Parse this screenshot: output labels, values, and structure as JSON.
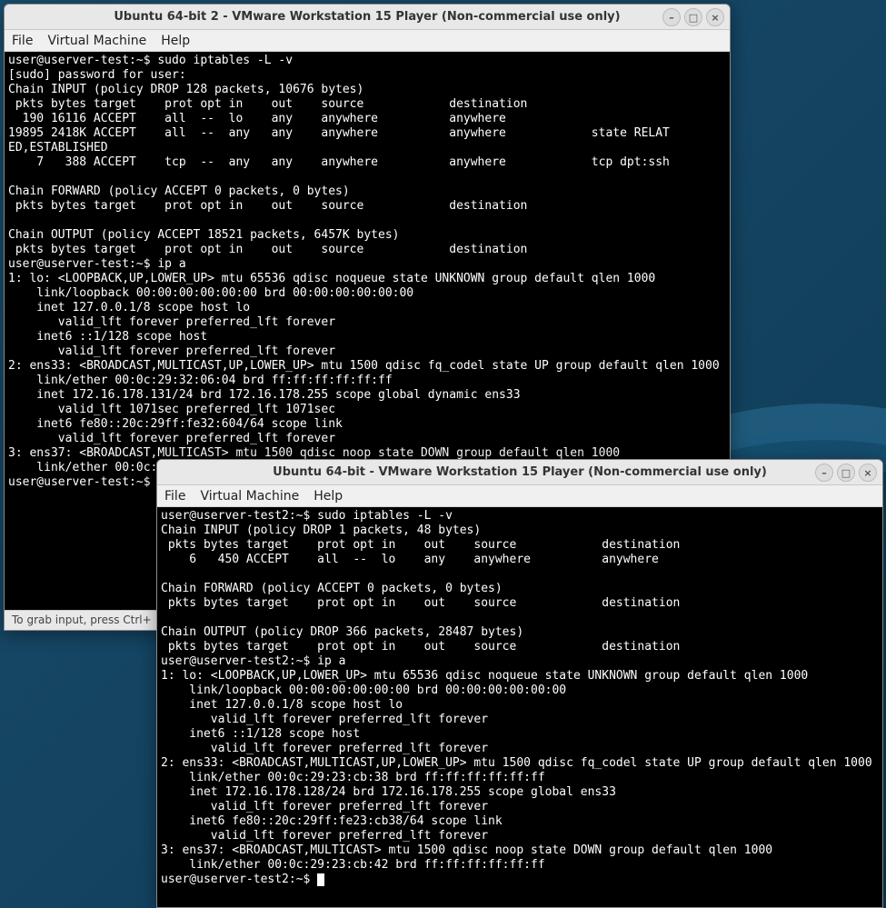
{
  "desktop": {
    "background_colors": [
      "#1a4d6d",
      "#0d3a55"
    ]
  },
  "window1": {
    "title": "Ubuntu 64-bit 2 - VMware Workstation 15 Player (Non-commercial use only)",
    "menu": {
      "file": "File",
      "vm": "Virtual Machine",
      "help": "Help"
    },
    "controls": {
      "min": "–",
      "max": "□",
      "close": "×"
    },
    "status": "To grab input, press Ctrl+",
    "terminal_lines": [
      "user@userver-test:~$ sudo iptables -L -v",
      "[sudo] password for user:",
      "Chain INPUT (policy DROP 128 packets, 10676 bytes)",
      " pkts bytes target    prot opt in    out    source            destination",
      "  190 16116 ACCEPT    all  --  lo    any    anywhere          anywhere",
      "19895 2418K ACCEPT    all  --  any   any    anywhere          anywhere            state RELAT",
      "ED,ESTABLISHED",
      "    7   388 ACCEPT    tcp  --  any   any    anywhere          anywhere            tcp dpt:ssh",
      "",
      "Chain FORWARD (policy ACCEPT 0 packets, 0 bytes)",
      " pkts bytes target    prot opt in    out    source            destination",
      "",
      "Chain OUTPUT (policy ACCEPT 18521 packets, 6457K bytes)",
      " pkts bytes target    prot opt in    out    source            destination",
      "user@userver-test:~$ ip a",
      "1: lo: <LOOPBACK,UP,LOWER_UP> mtu 65536 qdisc noqueue state UNKNOWN group default qlen 1000",
      "    link/loopback 00:00:00:00:00:00 brd 00:00:00:00:00:00",
      "    inet 127.0.0.1/8 scope host lo",
      "       valid_lft forever preferred_lft forever",
      "    inet6 ::1/128 scope host",
      "       valid_lft forever preferred_lft forever",
      "2: ens33: <BROADCAST,MULTICAST,UP,LOWER_UP> mtu 1500 qdisc fq_codel state UP group default qlen 1000",
      "    link/ether 00:0c:29:32:06:04 brd ff:ff:ff:ff:ff:ff",
      "    inet 172.16.178.131/24 brd 172.16.178.255 scope global dynamic ens33",
      "       valid_lft 1071sec preferred_lft 1071sec",
      "    inet6 fe80::20c:29ff:fe32:604/64 scope link",
      "       valid_lft forever preferred_lft forever",
      "3: ens37: <BROADCAST,MULTICAST> mtu 1500 qdisc noop state DOWN group default qlen 1000",
      "    link/ether 00:0c:",
      "user@userver-test:~$ "
    ]
  },
  "window2": {
    "title": "Ubuntu 64-bit - VMware Workstation 15 Player (Non-commercial use only)",
    "menu": {
      "file": "File",
      "vm": "Virtual Machine",
      "help": "Help"
    },
    "controls": {
      "min": "–",
      "max": "□",
      "close": "×"
    },
    "terminal_lines": [
      "user@userver-test2:~$ sudo iptables -L -v",
      "Chain INPUT (policy DROP 1 packets, 48 bytes)",
      " pkts bytes target    prot opt in    out    source            destination",
      "    6   450 ACCEPT    all  --  lo    any    anywhere          anywhere",
      "",
      "Chain FORWARD (policy ACCEPT 0 packets, 0 bytes)",
      " pkts bytes target    prot opt in    out    source            destination",
      "",
      "Chain OUTPUT (policy DROP 366 packets, 28487 bytes)",
      " pkts bytes target    prot opt in    out    source            destination",
      "user@userver-test2:~$ ip a",
      "1: lo: <LOOPBACK,UP,LOWER_UP> mtu 65536 qdisc noqueue state UNKNOWN group default qlen 1000",
      "    link/loopback 00:00:00:00:00:00 brd 00:00:00:00:00:00",
      "    inet 127.0.0.1/8 scope host lo",
      "       valid_lft forever preferred_lft forever",
      "    inet6 ::1/128 scope host",
      "       valid_lft forever preferred_lft forever",
      "2: ens33: <BROADCAST,MULTICAST,UP,LOWER_UP> mtu 1500 qdisc fq_codel state UP group default qlen 1000",
      "    link/ether 00:0c:29:23:cb:38 brd ff:ff:ff:ff:ff:ff",
      "    inet 172.16.178.128/24 brd 172.16.178.255 scope global ens33",
      "       valid_lft forever preferred_lft forever",
      "    inet6 fe80::20c:29ff:fe23:cb38/64 scope link",
      "       valid_lft forever preferred_lft forever",
      "3: ens37: <BROADCAST,MULTICAST> mtu 1500 qdisc noop state DOWN group default qlen 1000",
      "    link/ether 00:0c:29:23:cb:42 brd ff:ff:ff:ff:ff:ff",
      "user@userver-test2:~$ "
    ]
  }
}
